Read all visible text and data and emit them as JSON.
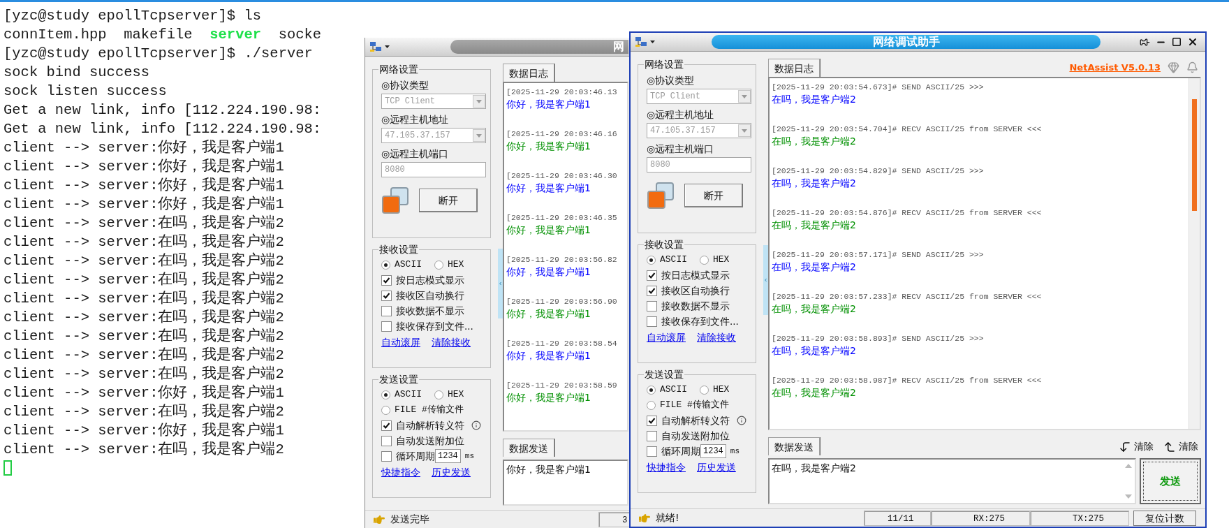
{
  "terminal": {
    "lines": [
      {
        "text": "[yzc@study epollTcpserver]$ ls"
      },
      {
        "parts": [
          {
            "text": "connItem.hpp",
            "kind": "file"
          },
          {
            "text": "makefile",
            "kind": "file"
          },
          {
            "text": "server",
            "kind": "executable"
          },
          {
            "text": "socke",
            "kind": "file"
          }
        ]
      },
      {
        "text": "[yzc@study epollTcpserver]$ ./server"
      },
      {
        "text": "sock bind success"
      },
      {
        "text": "sock listen success"
      },
      {
        "text": "Get a new link, info [112.224.190.98:"
      },
      {
        "text": "Get a new link, info [112.224.190.98:"
      },
      {
        "text": "client --> server:你好，我是客户端1"
      },
      {
        "text": "client --> server:你好，我是客户端1"
      },
      {
        "text": "client --> server:你好，我是客户端1"
      },
      {
        "text": "client --> server:你好，我是客户端1"
      },
      {
        "text": "client --> server:在吗，我是客户端2"
      },
      {
        "text": "client --> server:在吗，我是客户端2"
      },
      {
        "text": "client --> server:在吗，我是客户端2"
      },
      {
        "text": "client --> server:在吗，我是客户端2"
      },
      {
        "text": "client --> server:在吗，我是客户端2"
      },
      {
        "text": "client --> server:在吗，我是客户端2"
      },
      {
        "text": "client --> server:在吗，我是客户端2"
      },
      {
        "text": "client --> server:在吗，我是客户端2"
      },
      {
        "text": "client --> server:在吗，我是客户端2"
      },
      {
        "text": "client --> server:你好，我是客户端1"
      },
      {
        "text": "client --> server:在吗，我是客户端2"
      },
      {
        "text": "client --> server:你好，我是客户端1"
      },
      {
        "text": "client --> server:在吗，我是客户端2"
      }
    ],
    "cursor": true
  },
  "windows": [
    {
      "title": "网",
      "network_settings": {
        "title": "网络设置",
        "fields": [
          {
            "label": "◎协议类型",
            "value": "TCP Client",
            "kind": "dropdown",
            "disabled": true
          },
          {
            "label": "◎远程主机地址",
            "value": "47.105.37.157",
            "kind": "dropdown",
            "disabled": true
          },
          {
            "label": "◎远程主机端口",
            "value": "8080",
            "kind": "text",
            "disabled": true
          }
        ],
        "connect_button": "断开"
      },
      "receive_settings": {
        "title": "接收设置",
        "encoding": [
          {
            "label": "ASCII",
            "selected": true
          },
          {
            "label": "HEX",
            "selected": false
          }
        ],
        "options": [
          {
            "label": "按日志模式显示",
            "checked": true
          },
          {
            "label": "接收区自动换行",
            "checked": true
          },
          {
            "label": "接收数据不显示",
            "checked": false
          },
          {
            "label": "接收保存到文件...",
            "checked": false
          }
        ],
        "links": [
          "自动滚屏",
          "清除接收"
        ]
      },
      "send_settings": {
        "title": "发送设置",
        "encoding": [
          {
            "label": "ASCII",
            "selected": true
          },
          {
            "label": "HEX",
            "selected": false
          },
          {
            "label": "FILE #传输文件",
            "selected": false
          }
        ],
        "options": [
          {
            "label": "自动解析转义符",
            "checked": true,
            "info": true
          },
          {
            "label": "自动发送附加位",
            "checked": false
          },
          {
            "label": "循环周期",
            "checked": false,
            "interval": "1234",
            "unit": "ms"
          }
        ],
        "links": [
          "快捷指令",
          "历史发送"
        ]
      },
      "log": {
        "tab": "数据日志",
        "entries": [
          {
            "header": "[2025-11-29 20:03:46.13",
            "message": "你好，我是客户端1",
            "sent": true
          },
          {
            "header": "[2025-11-29 20:03:46.16",
            "message": "你好，我是客户端1",
            "sent": false
          },
          {
            "header": "[2025-11-29 20:03:46.30",
            "message": "你好，我是客户端1",
            "sent": true
          },
          {
            "header": "[2025-11-29 20:03:46.35",
            "message": "你好，我是客户端1",
            "sent": false
          },
          {
            "header": "[2025-11-29 20:03:56.82",
            "message": "你好，我是客户端1",
            "sent": true
          },
          {
            "header": "[2025-11-29 20:03:56.90",
            "message": "你好，我是客户端1",
            "sent": false
          },
          {
            "header": "[2025-11-29 20:03:58.54",
            "message": "你好，我是客户端1",
            "sent": true
          },
          {
            "header": "[2025-11-29 20:03:58.59",
            "message": "你好，我是客户端1",
            "sent": false
          }
        ]
      },
      "send": {
        "tab": "数据发送",
        "value": "你好，我是客户端1"
      },
      "status": {
        "message": "发送完毕",
        "counters": [
          "3"
        ]
      }
    },
    {
      "title": "网络调试助手",
      "version_link": "NetAssist V5.0.13",
      "network_settings": {
        "title": "网络设置",
        "fields": [
          {
            "label": "◎协议类型",
            "value": "TCP Client",
            "kind": "dropdown",
            "disabled": true
          },
          {
            "label": "◎远程主机地址",
            "value": "47.105.37.157",
            "kind": "dropdown",
            "disabled": true
          },
          {
            "label": "◎远程主机端口",
            "value": "8080",
            "kind": "text",
            "disabled": true
          }
        ],
        "connect_button": "断开"
      },
      "receive_settings": {
        "title": "接收设置",
        "encoding": [
          {
            "label": "ASCII",
            "selected": true
          },
          {
            "label": "HEX",
            "selected": false
          }
        ],
        "options": [
          {
            "label": "按日志模式显示",
            "checked": true
          },
          {
            "label": "接收区自动换行",
            "checked": true
          },
          {
            "label": "接收数据不显示",
            "checked": false
          },
          {
            "label": "接收保存到文件...",
            "checked": false
          }
        ],
        "links": [
          "自动滚屏",
          "清除接收"
        ]
      },
      "send_settings": {
        "title": "发送设置",
        "encoding": [
          {
            "label": "ASCII",
            "selected": true
          },
          {
            "label": "HEX",
            "selected": false
          },
          {
            "label": "FILE #传输文件",
            "selected": false
          }
        ],
        "options": [
          {
            "label": "自动解析转义符",
            "checked": true,
            "info": true
          },
          {
            "label": "自动发送附加位",
            "checked": false
          },
          {
            "label": "循环周期",
            "checked": false,
            "interval": "1234",
            "unit": "ms"
          }
        ],
        "links": [
          "快捷指令",
          "历史发送"
        ]
      },
      "log": {
        "tab": "数据日志",
        "entries": [
          {
            "header": "[2025-11-29 20:03:54.673]# SEND ASCII/25 >>>",
            "message": "在吗，我是客户端2",
            "sent": true
          },
          {
            "header": "[2025-11-29 20:03:54.704]# RECV ASCII/25 from SERVER <<<",
            "message": "在吗，我是客户端2",
            "sent": false
          },
          {
            "header": "[2025-11-29 20:03:54.829]# SEND ASCII/25 >>>",
            "message": "在吗，我是客户端2",
            "sent": true
          },
          {
            "header": "[2025-11-29 20:03:54.876]# RECV ASCII/25 from SERVER <<<",
            "message": "在吗，我是客户端2",
            "sent": false
          },
          {
            "header": "[2025-11-29 20:03:57.171]# SEND ASCII/25 >>>",
            "message": "在吗，我是客户端2",
            "sent": true
          },
          {
            "header": "[2025-11-29 20:03:57.233]# RECV ASCII/25 from SERVER <<<",
            "message": "在吗，我是客户端2",
            "sent": false
          },
          {
            "header": "[2025-11-29 20:03:58.893]# SEND ASCII/25 >>>",
            "message": "在吗，我是客户端2",
            "sent": true
          },
          {
            "header": "[2025-11-29 20:03:58.987]# RECV ASCII/25 from SERVER <<<",
            "message": "在吗，我是客户端2",
            "sent": false
          }
        ]
      },
      "send": {
        "tab": "数据发送",
        "value": "在吗，我是客户端2",
        "clear_buttons": [
          "清除",
          "清除"
        ],
        "send_button": "发送"
      },
      "status": {
        "message": "就绪!",
        "counters": [
          "11/11",
          "RX:275",
          "TX:275"
        ],
        "reset_button": "复位计数"
      }
    }
  ]
}
